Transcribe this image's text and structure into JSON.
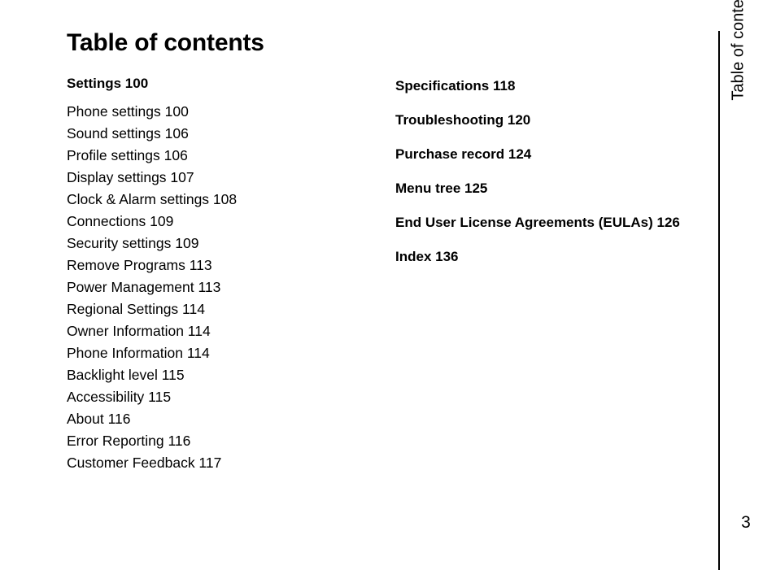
{
  "page": {
    "title": "Table of contents",
    "number": "3",
    "sidebar_label": "Table of contents"
  },
  "left_column": {
    "heading": "Settings 100",
    "entries": [
      "Phone settings 100",
      "Sound settings 106",
      "Profile settings 106",
      "Display settings 107",
      "Clock & Alarm settings 108",
      "Connections 109",
      "Security settings 109",
      "Remove Programs 113",
      "Power Management 113",
      "Regional Settings 114",
      "Owner Information 114",
      "Phone Information 114",
      "Backlight level 115",
      "Accessibility 115",
      "About 116",
      "Error Reporting 116",
      "Customer Feedback 117"
    ]
  },
  "right_column": {
    "entries": [
      "Specifications 118",
      "Troubleshooting 120",
      "Purchase record 124",
      "Menu tree 125",
      "End User License Agreements (EULAs) 126",
      "Index 136"
    ]
  }
}
